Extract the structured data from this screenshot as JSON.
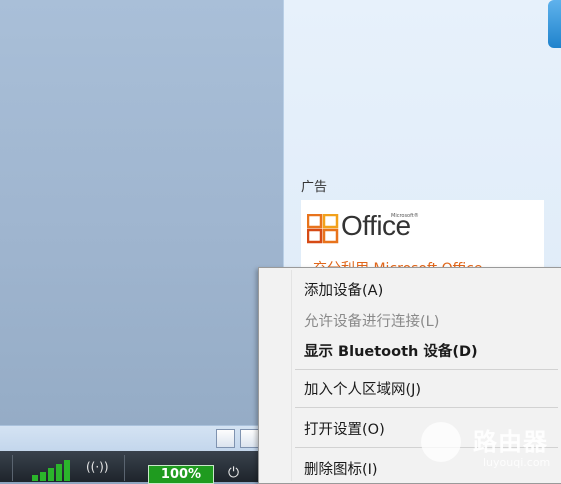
{
  "ad_panel": {
    "label": "广告",
    "office_brand_small": "Microsoft®",
    "office_brand": "Office",
    "promo_text": "充分利用 Microsoft Office"
  },
  "tray": {
    "battery_percent": "100%",
    "battery_level": 1.0,
    "signal_bars": 5
  },
  "context_menu": {
    "items": [
      {
        "label": "添加设备(A)",
        "enabled": true,
        "bold": false
      },
      {
        "label": "允许设备进行连接(L)",
        "enabled": false,
        "bold": false
      },
      {
        "label": "显示 Bluetooth 设备(D)",
        "enabled": true,
        "bold": true
      },
      {
        "label": "加入个人区域网(J)",
        "enabled": true,
        "bold": false
      },
      {
        "label": "打开设置(O)",
        "enabled": true,
        "bold": false
      },
      {
        "label": "删除图标(I)",
        "enabled": true,
        "bold": false
      }
    ]
  },
  "watermark": {
    "title": "路由器",
    "url": "luyouqi.com"
  },
  "colors": {
    "accent_blue": "#1f83cc",
    "ad_orange": "#e0661a",
    "battery_green": "#1f9b1f"
  },
  "icons": [
    "office-logo-icon",
    "signal-icon",
    "wifi-icon",
    "battery-icon",
    "power-icon",
    "router-watermark-icon"
  ]
}
